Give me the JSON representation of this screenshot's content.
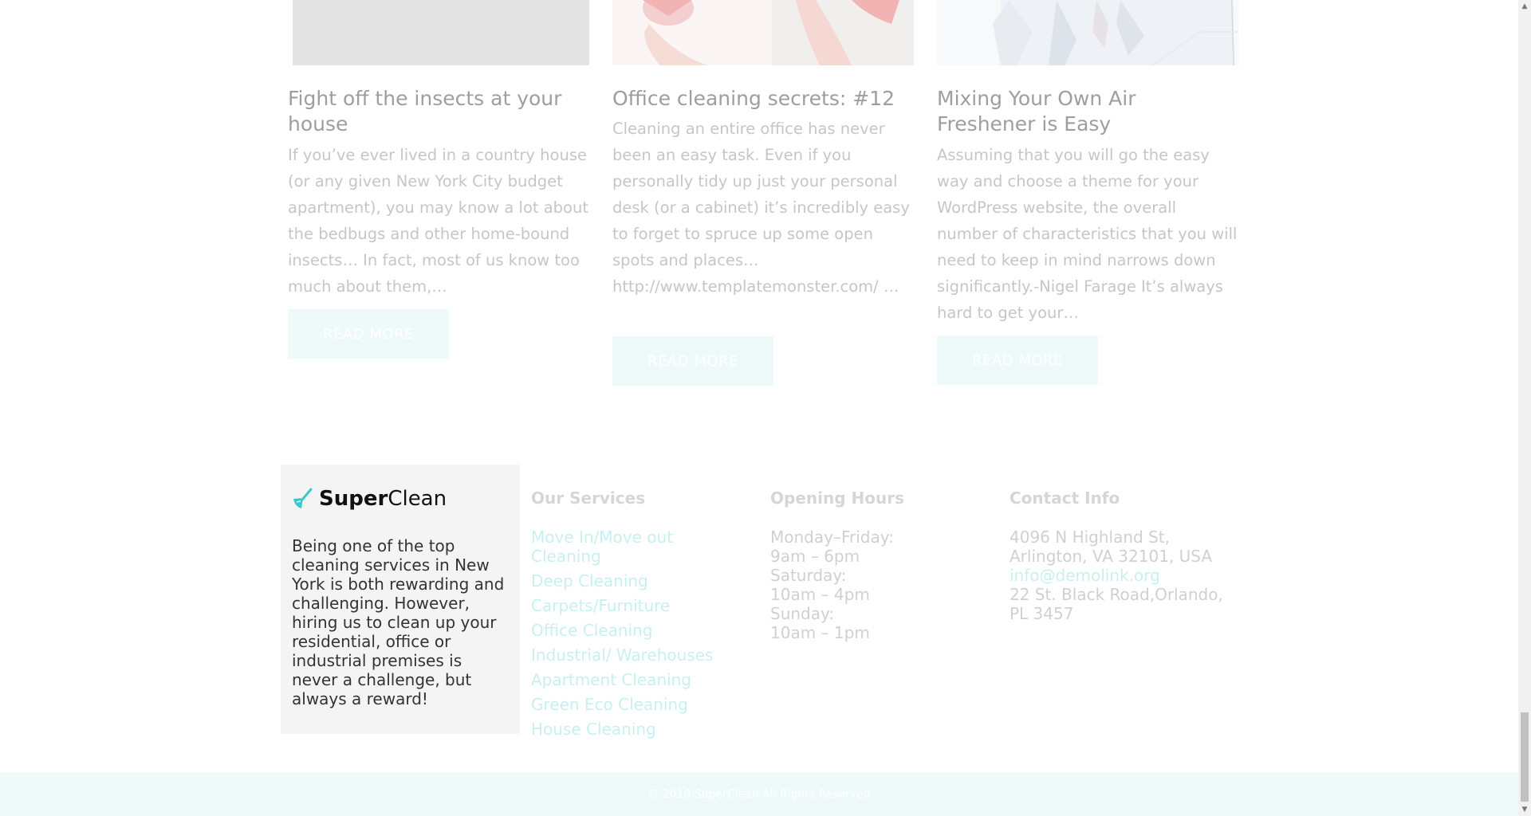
{
  "posts": [
    {
      "title": "Fight off the insects at your house",
      "excerpt": "   If you’ve ever lived in a country house (or any given New York City budget apartment), you may know a lot about the bedbugs and other home-bound insects… In fact, most of us know too much about them,…",
      "button": "READ MORE"
    },
    {
      "title": "Office cleaning secrets: #12",
      "excerpt": "  Cleaning an entire office has never been an easy task. Even if you personally tidy up just your personal desk (or a cabinet) it’s incredibly easy to forget to spruce up some open spots and places… http://www.templatemonster.com/ …",
      "button": "READ MORE"
    },
    {
      "title": "Mixing Your Own Air Freshener is Easy",
      "excerpt": "Assuming that you will go the easy way and choose a theme for your WordPress website, the overall number of characteristics that you will need to keep in mind narrows down significantly.-Nigel Farage   It’s always hard to get your…",
      "button": "READ MORE"
    }
  ],
  "footer": {
    "brand_bold": "Super",
    "brand_light": "Clean",
    "description": "Being one of the top cleaning services in New York is both rewarding and challenging. However, hiring us to clean up your residential, office or industrial premises is never a challenge, but always a reward!",
    "services_title": "Our Services",
    "services": [
      "Move In/Move out Cleaning",
      "Deep Cleaning",
      "Carpets/Furniture",
      "Office Cleaning",
      "Industrial/ Warehouses",
      "Apartment Cleaning",
      "Green Eco Cleaning",
      "House Cleaning"
    ],
    "hours_title": "Opening Hours",
    "hours": [
      "Monday–Friday:",
      "9am – 6pm",
      "Saturday:",
      "10am – 4pm",
      "Sunday:",
      "10am – 1pm"
    ],
    "contact_title": "Contact Info",
    "address_1": "4096 N Highland St, Arlington, VA 32101, USA",
    "email": "info@demolink.org",
    "address_2": "22 St. Black Road,Orlando, PL 3457",
    "copyright": "© 2018 SuperClean.All Rights Reserved"
  },
  "colors": {
    "accent": "#3cc8c6",
    "accent_faded": "#c7f0ef",
    "button_bg": "#eefafa"
  }
}
